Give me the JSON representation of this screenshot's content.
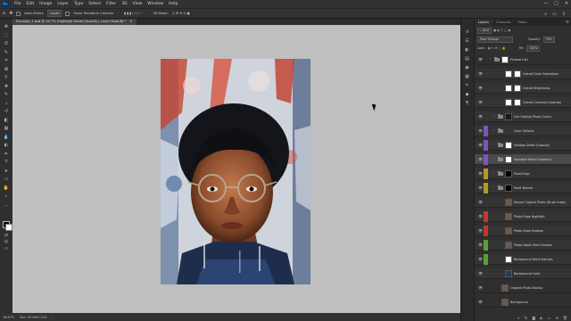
{
  "app": {
    "logo": "Ps"
  },
  "menu": [
    "File",
    "Edit",
    "Image",
    "Layer",
    "Type",
    "Select",
    "Filter",
    "3D",
    "View",
    "Window",
    "Help"
  ],
  "window_controls": [
    "—",
    "□",
    "✕"
  ],
  "options_bar": {
    "auto_select_label": "Auto-Select:",
    "auto_select_value": "Layer",
    "transform_label": "Show Transform Controls",
    "mode_3d": "3D Mode:"
  },
  "document": {
    "tab_title": "Example_1.psd @ 16.7% (Highlight Detail (Opacity), Layer Mask/8) *",
    "zoom": "16.67%",
    "doc_size": "Doc: 59.4M/2.22G"
  },
  "layers_panel": {
    "tabs": [
      "Layers",
      "Channels",
      "Paths"
    ],
    "filter_kind": "Kind",
    "blend_mode": "Pass Through",
    "opacity_label": "Opacity:",
    "opacity_value": "70%",
    "lock_label": "Lock:",
    "fill_label": "Fill:",
    "fill_value": "100%",
    "layers": [
      {
        "name": "Photoart Art",
        "type": "group",
        "color": "",
        "level": 0,
        "thumb": "mask"
      },
      {
        "name": "Overall Color Saturation",
        "type": "adjustment",
        "color": "",
        "level": 1,
        "thumb": "mask"
      },
      {
        "name": "Overall Brightness",
        "type": "adjustment",
        "color": "",
        "level": 1,
        "thumb": "mask"
      },
      {
        "name": "Overall Contrast (Opacity)",
        "type": "adjustment",
        "color": "",
        "level": 1,
        "thumb": "mask"
      },
      {
        "name": "Use Original Photo Colors",
        "type": "group",
        "color": "",
        "level": 1,
        "thumb": "dark"
      },
      {
        "name": "Color Options",
        "type": "group",
        "color": "#7a57b8",
        "level": 1,
        "thumb": "none"
      },
      {
        "name": "Shadow Detail (Opacity)",
        "type": "group",
        "color": "#7a57b8",
        "level": 1,
        "thumb": "mask"
      },
      {
        "name": "Highlight Detail (Opacity)",
        "type": "group",
        "color": "#7a57b8",
        "level": 1,
        "thumb": "mask",
        "selected": true
      },
      {
        "name": "Paint Drips",
        "type": "group",
        "color": "#b49a22",
        "level": 1,
        "thumb": "black"
      },
      {
        "name": "Paint Texture",
        "type": "group",
        "color": "#b49a22",
        "level": 1,
        "thumb": "black"
      },
      {
        "name": "Reveal Original Photo (Brush mask)",
        "type": "layer",
        "color": "",
        "level": 1,
        "thumb": "photo"
      },
      {
        "name": "Photo Edge Highlight",
        "type": "layer",
        "color": "#c0392b",
        "level": 1,
        "thumb": "photo"
      },
      {
        "name": "Photo Edge Shadow",
        "type": "layer",
        "color": "#c0392b",
        "level": 1,
        "thumb": "photo"
      },
      {
        "name": "Photo Detail Paint Strokes",
        "type": "layer",
        "color": "#5a9e3a",
        "level": 1,
        "thumb": "photo"
      },
      {
        "name": "Background Paint Textures",
        "type": "layer",
        "color": "#5a9e3a",
        "level": 1,
        "thumb": "mask"
      },
      {
        "name": "Background Color",
        "type": "layer",
        "color": "",
        "level": 1,
        "thumb": "navy"
      },
      {
        "name": "Original Photo Backup",
        "type": "layer",
        "color": "",
        "level": 0,
        "thumb": "photo"
      },
      {
        "name": "Background",
        "type": "layer",
        "color": "",
        "level": 0,
        "thumb": "photo"
      }
    ]
  }
}
